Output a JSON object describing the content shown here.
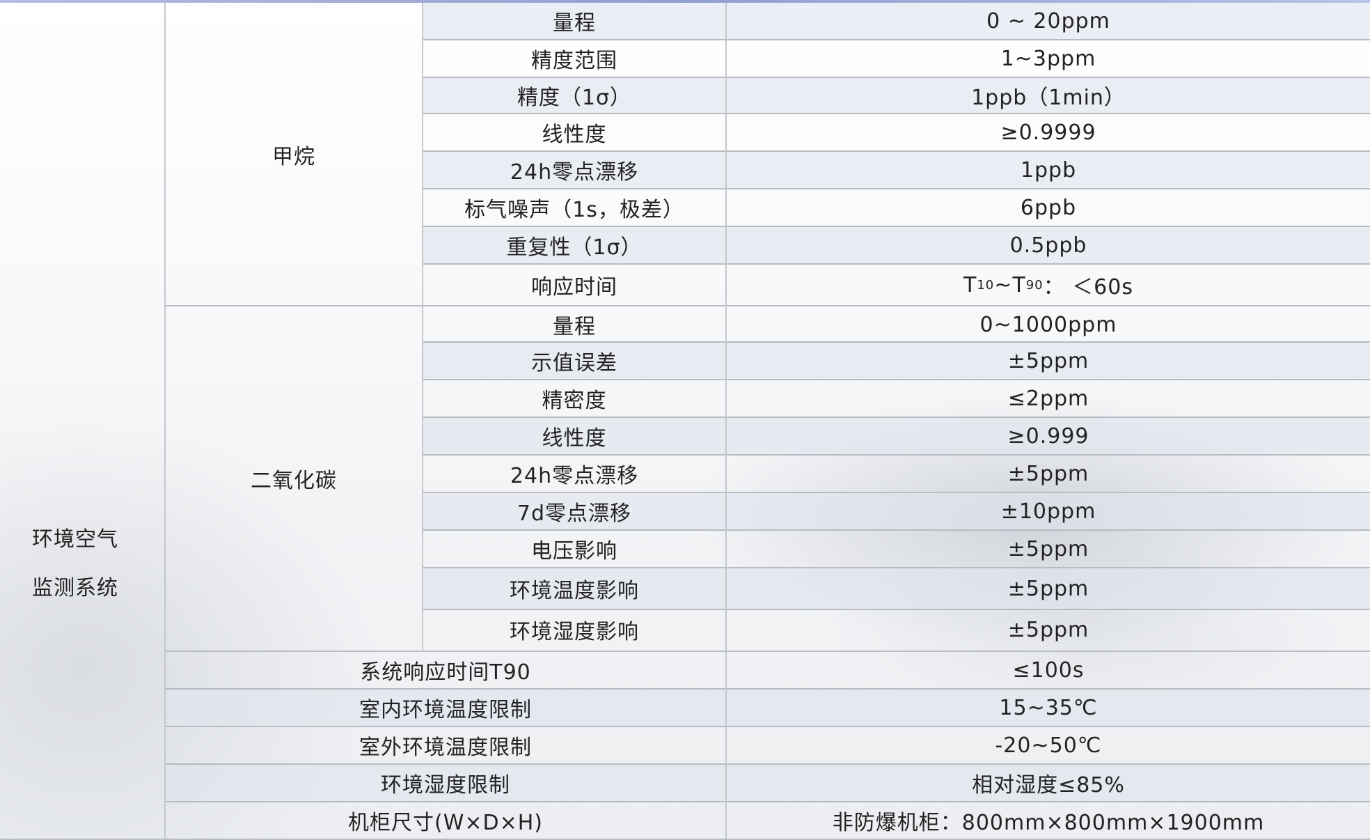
{
  "system": {
    "line1": "环境空气",
    "line2": "监测系统"
  },
  "methane": {
    "name": "甲烷",
    "rows": [
      {
        "param": "量程",
        "value": "0 ~ 20ppm"
      },
      {
        "param": "精度范围",
        "value": "1~3ppm"
      },
      {
        "param": "精度（1σ）",
        "value": "1ppb（1min）"
      },
      {
        "param": "线性度",
        "value": "≥0.9999"
      },
      {
        "param": "24h零点漂移",
        "value": "1ppb"
      },
      {
        "param": "标气噪声（1s，极差）",
        "value": "6ppb"
      },
      {
        "param": "重复性（1σ）",
        "value": "0.5ppb"
      },
      {
        "param": "响应时间",
        "value_prefix": "T",
        "value_sub1": "10",
        "value_mid": "~T",
        "value_sub2": "90",
        "value_suffix": "： ＜60s"
      }
    ]
  },
  "co2": {
    "name": "二氧化碳",
    "rows": [
      {
        "param": "量程",
        "value": "0~1000ppm"
      },
      {
        "param": "示值误差",
        "value": "±5ppm"
      },
      {
        "param": "精密度",
        "value": "≤2ppm"
      },
      {
        "param": "线性度",
        "value": "≥0.999"
      },
      {
        "param": "24h零点漂移",
        "value": "±5ppm"
      },
      {
        "param": "7d零点漂移",
        "value": "±10ppm"
      },
      {
        "param": "电压影响",
        "value": "±5ppm"
      },
      {
        "param": "环境温度影响",
        "value": "±5ppm"
      },
      {
        "param": "环境湿度影响",
        "value": "±5ppm"
      }
    ]
  },
  "general": [
    {
      "param": "系统响应时间T90",
      "value": "≤100s"
    },
    {
      "param": "室内环境温度限制",
      "value": "15~35℃"
    },
    {
      "param": "室外环境温度限制",
      "value": "-20~50℃"
    },
    {
      "param": "环境湿度限制",
      "value": "相对湿度≤85%"
    },
    {
      "param": "机柜尺寸(W×D×H)",
      "value": "非防爆机柜：800mm×800mm×1900mm"
    }
  ]
}
